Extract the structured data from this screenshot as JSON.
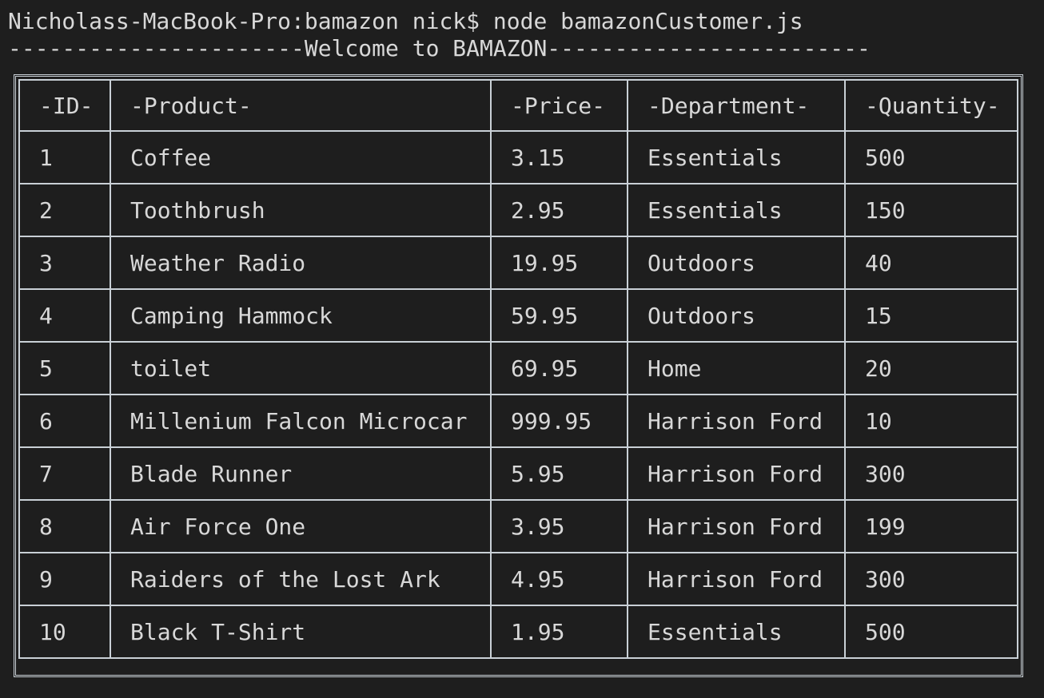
{
  "terminal": {
    "prompt_line": "Nicholass-MacBook-Pro:bamazon nick$ node bamazonCustomer.js",
    "welcome_line": "----------------------Welcome to BAMAZON------------------------"
  },
  "table": {
    "headers": [
      "-ID-",
      "-Product-",
      "-Price-",
      "-Department-",
      "-Quantity-"
    ],
    "rows": [
      [
        "1",
        "Coffee",
        "3.15",
        "Essentials",
        "500"
      ],
      [
        "2",
        "Toothbrush",
        "2.95",
        "Essentials",
        "150"
      ],
      [
        "3",
        "Weather Radio",
        "19.95",
        "Outdoors",
        "40"
      ],
      [
        "4",
        "Camping Hammock",
        "59.95",
        "Outdoors",
        "15"
      ],
      [
        "5",
        "toilet",
        "69.95",
        "Home",
        "20"
      ],
      [
        "6",
        "Millenium Falcon Microcar",
        "999.95",
        "Harrison Ford",
        "10"
      ],
      [
        "7",
        "Blade Runner",
        "5.95",
        "Harrison Ford",
        "300"
      ],
      [
        "8",
        "Air Force One",
        "3.95",
        "Harrison Ford",
        "199"
      ],
      [
        "9",
        "Raiders of the Lost Ark",
        "4.95",
        "Harrison Ford",
        "300"
      ],
      [
        "10",
        "Black T-Shirt",
        "1.95",
        "Essentials",
        "500"
      ]
    ]
  }
}
